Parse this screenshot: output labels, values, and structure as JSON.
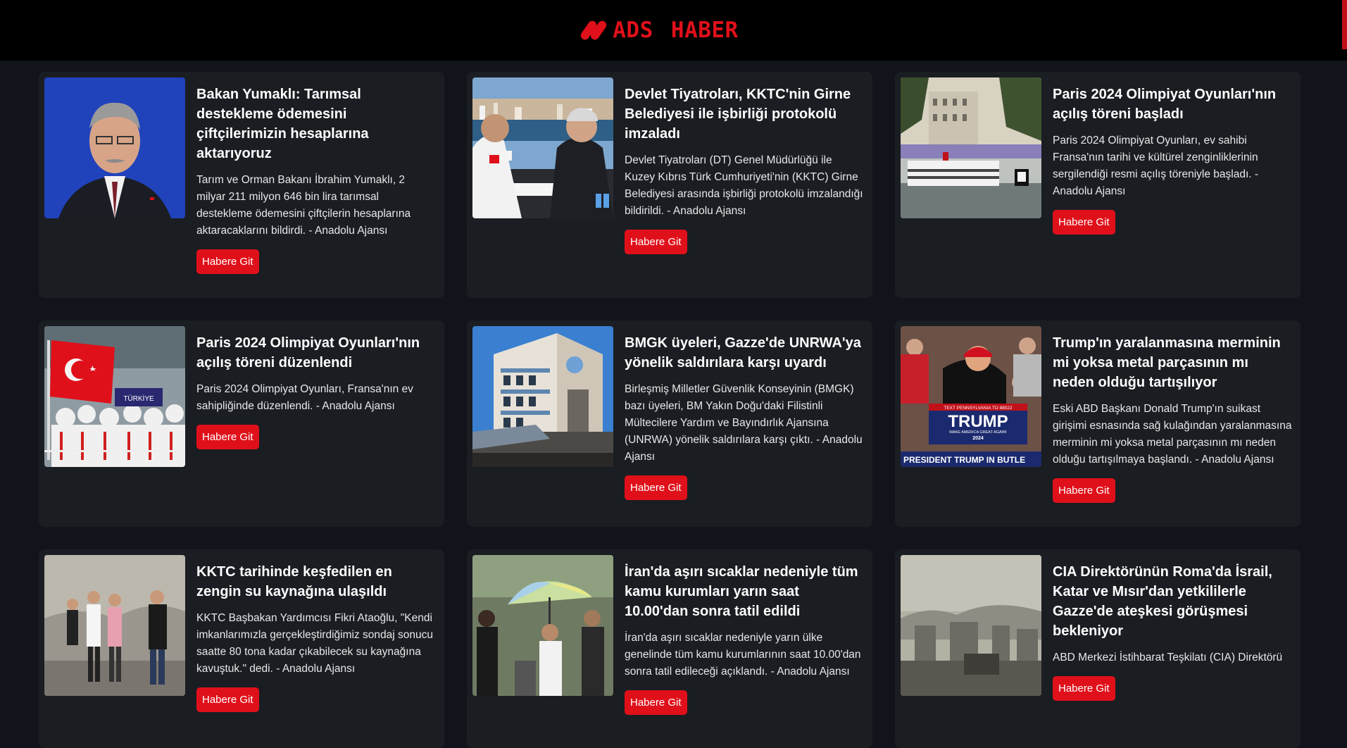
{
  "header": {
    "brand": "ADS HABER",
    "brand_color": "#e0101a",
    "logo_icon": "double-slash-logo"
  },
  "button_color": "#e0101a",
  "cards": [
    {
      "title": "Bakan Yumaklı: Tarımsal destekleme ödemesini çiftçilerimizin hesaplarına aktarıyoruz",
      "description": "Tarım ve Orman Bakanı İbrahim Yumaklı, 2 milyar 211 milyon 646 bin lira tarımsal destekleme ödemesini çiftçilerin hesaplarına aktaracaklarını bildirdi. - Anadolu Ajansı",
      "button": "Habere Git"
    },
    {
      "title": "Devlet Tiyatroları, KKTC'nin Girne Belediyesi ile işbirliği protokolü imzaladı",
      "description": "Devlet Tiyatroları (DT) Genel Müdürlüğü ile Kuzey Kıbrıs Türk Cumhuriyeti'nin (KKTC) Girne Belediyesi arasında işbirliği protokolü imzalandığı bildirildi. - Anadolu Ajansı",
      "button": "Habere Git"
    },
    {
      "title": "Paris 2024 Olimpiyat Oyunları'nın açılış töreni başladı",
      "description": "Paris 2024 Olimpiyat Oyunları, ev sahibi Fransa'nın tarihi ve kültürel zenginliklerinin sergilendiği resmi açılış töreniyle başladı. - Anadolu Ajansı",
      "button": "Habere Git"
    },
    {
      "title": "Paris 2024 Olimpiyat Oyunları'nın açılış töreni düzenlendi",
      "description": "Paris 2024 Olimpiyat Oyunları, Fransa'nın ev sahipliğinde düzenlendi. - Anadolu Ajansı",
      "button": "Habere Git",
      "image_text": "TÜRKİYE"
    },
    {
      "title": "BMGK üyeleri, Gazze'de UNRWA'ya yönelik saldırılara karşı uyardı",
      "description": "Birleşmiş Milletler Güvenlik Konseyinin (BMGK) bazı üyeleri, BM Yakın Doğu'daki Filistinli Mültecilere Yardım ve Bayındırlık Ajansına (UNRWA) yönelik saldırılara karşı çıktı. - Anadolu Ajansı",
      "button": "Habere Git"
    },
    {
      "title": "Trump'ın yaralanmasına merminin mi yoksa metal parçasının mı neden olduğu tartışılıyor",
      "description": "Eski ABD Başkanı Donald Trump'ın suikast girişimi esnasında sağ kulağından yaralanmasına merminin mi yoksa metal parçasının mı neden olduğu tartışılmaya başlandı. - Anadolu Ajansı",
      "button": "Habere Git",
      "image_text_top": "TEXT PENNSYLVANIA TO 88022",
      "image_text_main": "TRUMP",
      "image_text_sub": "MAKE AMERICA GREAT AGAIN!",
      "image_text_year": "2024",
      "image_text_bottom": "PRESIDENT TRUMP IN BUTLE"
    },
    {
      "title": "KKTC tarihinde keşfedilen en zengin su kaynağına ulaşıldı",
      "description": "KKTC Başbakan Yardımcısı Fikri Ataoğlu, \"Kendi imkanlarımızla gerçekleştirdiğimiz sondaj sonucu saatte 80 tona kadar çıkabilecek su kaynağına kavuştuk.\" dedi. - Anadolu Ajansı",
      "button": "Habere Git"
    },
    {
      "title": "İran'da aşırı sıcaklar nedeniyle tüm kamu kurumları yarın saat 10.00'dan sonra tatil edildi",
      "description": "İran'da aşırı sıcaklar nedeniyle yarın ülke genelinde tüm kamu kurumlarının saat 10.00'dan sonra tatil edileceği açıklandı. - Anadolu Ajansı",
      "button": "Habere Git"
    },
    {
      "title": "CIA Direktörünün Roma'da İsrail, Katar ve Mısır'dan yetkililerle Gazze'de ateşkesi görüşmesi bekleniyor",
      "description": "ABD Merkezi İstihbarat Teşkilatı (CIA) Direktörü",
      "button": "Habere Git"
    }
  ]
}
